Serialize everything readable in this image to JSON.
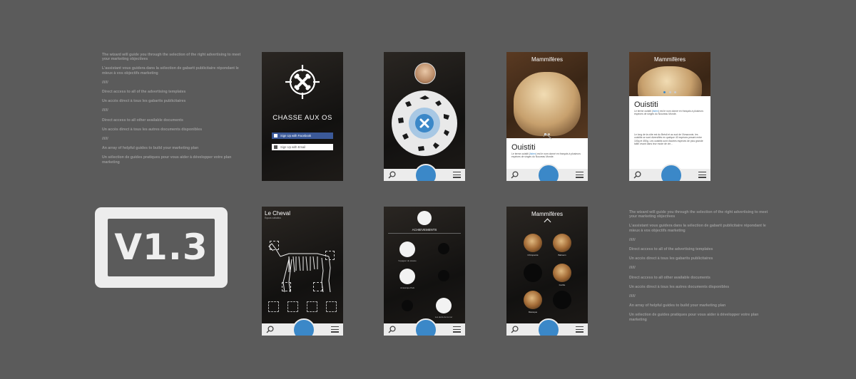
{
  "notes": [
    "The wizard will guide you through the selection of the right advertising to meet your marketing objectives",
    "L'assistant vous guidera dans la sélection de gabarit publicitaire répondant le mieux à vos objectifs marketing",
    "//////",
    "Direct access to all of the advertising templates",
    "Un accès direct à tous les gabarits publicitaires",
    "//////",
    "Direct access to all other available documents",
    "Un accès direct à tous les autres documents disponibles",
    "//////",
    "An array of helpful guides to build your marketing plan",
    "Un sélection de guides pratiques pour vous aider à développer votre plan marketing"
  ],
  "version": "V1.3",
  "login": {
    "app_title": "CHASSE AUX OS",
    "facebook_label": "Sign Up with Facebook",
    "email_label": "Sign Up with Email"
  },
  "detail": {
    "category": "Mammifères",
    "animal": "Ouistiti",
    "short_desc_a": "Le terme ouistiti (",
    "short_link": "listen",
    "short_desc_b": ") est le nom donné en français à plusieurs espèces de singes du Nouveau Monde.",
    "long_desc": "Le long de la côte est du Brésil et au sud de l'Amazonie, les ouistitis se sont diversifiés en quelque 40 espèces pesant entre 100g et 450g. Les ouistitis sont d'autres espèces de plus grande taille vivant dans leur mode de vie..."
  },
  "skeleton": {
    "title": "Le Cheval",
    "subtitle": "Equus caballus"
  },
  "achievements": {
    "title": "ACHIEVEMENTS",
    "items": [
      "Voyageur du savane",
      "Jurassique Park",
      "Les dents de la mer"
    ]
  },
  "collection": {
    "category": "Mammifères",
    "items": [
      "Chimpanzé",
      "Babouin",
      "Gorille",
      "Macaque"
    ]
  },
  "colors": {
    "background": "#5b5b5b",
    "accent": "#3b88c8",
    "facebook": "#3b5998"
  }
}
